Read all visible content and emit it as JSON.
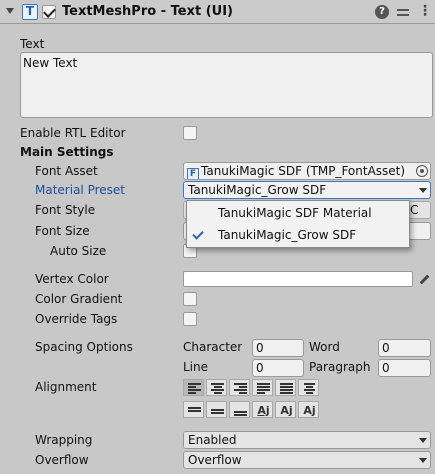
{
  "header": {
    "title": "TextMeshPro - Text (UI)",
    "enabled": true,
    "help_glyph": "?",
    "menu_glyph": "⋮",
    "component_icon_glyph": "T"
  },
  "text_section": {
    "label": "Text",
    "value": "New Text"
  },
  "enable_rtl": {
    "label": "Enable RTL Editor",
    "checked": false
  },
  "main_settings": {
    "heading": "Main Settings",
    "font_asset": {
      "label": "Font Asset",
      "value": "TanukiMagic SDF (TMP_FontAsset)",
      "icon_glyph": "F"
    },
    "material_preset": {
      "label": "Material Preset",
      "value": "TanukiMagic_Grow SDF"
    },
    "font_style": {
      "label": "Font Style",
      "partial_button": "C"
    },
    "font_size": {
      "label": "Font Size"
    },
    "auto_size": {
      "label": "Auto Size"
    },
    "vertex_color": {
      "label": "Vertex Color"
    },
    "color_gradient": {
      "label": "Color Gradient"
    },
    "override_tags": {
      "label": "Override Tags"
    },
    "spacing": {
      "label": "Spacing Options",
      "character_label": "Character",
      "character_value": "0",
      "word_label": "Word",
      "word_value": "0",
      "line_label": "Line",
      "line_value": "0",
      "paragraph_label": "Paragraph",
      "paragraph_value": "0"
    },
    "alignment": {
      "label": "Alignment"
    },
    "wrapping": {
      "label": "Wrapping",
      "value": "Enabled"
    },
    "overflow": {
      "label": "Overflow",
      "value": "Overflow"
    }
  },
  "popup": {
    "items": [
      {
        "label": "TanukiMagic SDF Material",
        "checked": false
      },
      {
        "label": "TanukiMagic_Grow SDF",
        "checked": true
      }
    ]
  },
  "colors": {
    "background": "#c8c8c8",
    "accent_blue": "#3a78c2",
    "label_focused": "#1c4fa0"
  }
}
